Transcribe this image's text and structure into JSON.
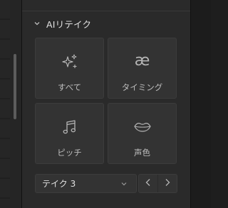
{
  "section": {
    "title": "AIリテイク",
    "collapse_icon": "chevron-down-icon"
  },
  "tiles": [
    {
      "label": "すべて",
      "icon": "sparkle-icon"
    },
    {
      "label": "タイミング",
      "icon": "ae-ligature-icon",
      "glyph": "æ"
    },
    {
      "label": "ピッチ",
      "icon": "music-note-icon"
    },
    {
      "label": "声色",
      "icon": "lips-icon"
    }
  ],
  "take_select": {
    "value": "テイク 3",
    "icon": "chevron-down-icon"
  },
  "nav": {
    "prev_icon": "chevron-left-icon",
    "next_icon": "chevron-right-icon"
  },
  "colors": {
    "panel_bg": "#2a2a2a",
    "tile_bg": "#333333",
    "tile_border": "#3c3c3c",
    "icon": "#b5b5b5",
    "label": "#bdbdbd"
  }
}
